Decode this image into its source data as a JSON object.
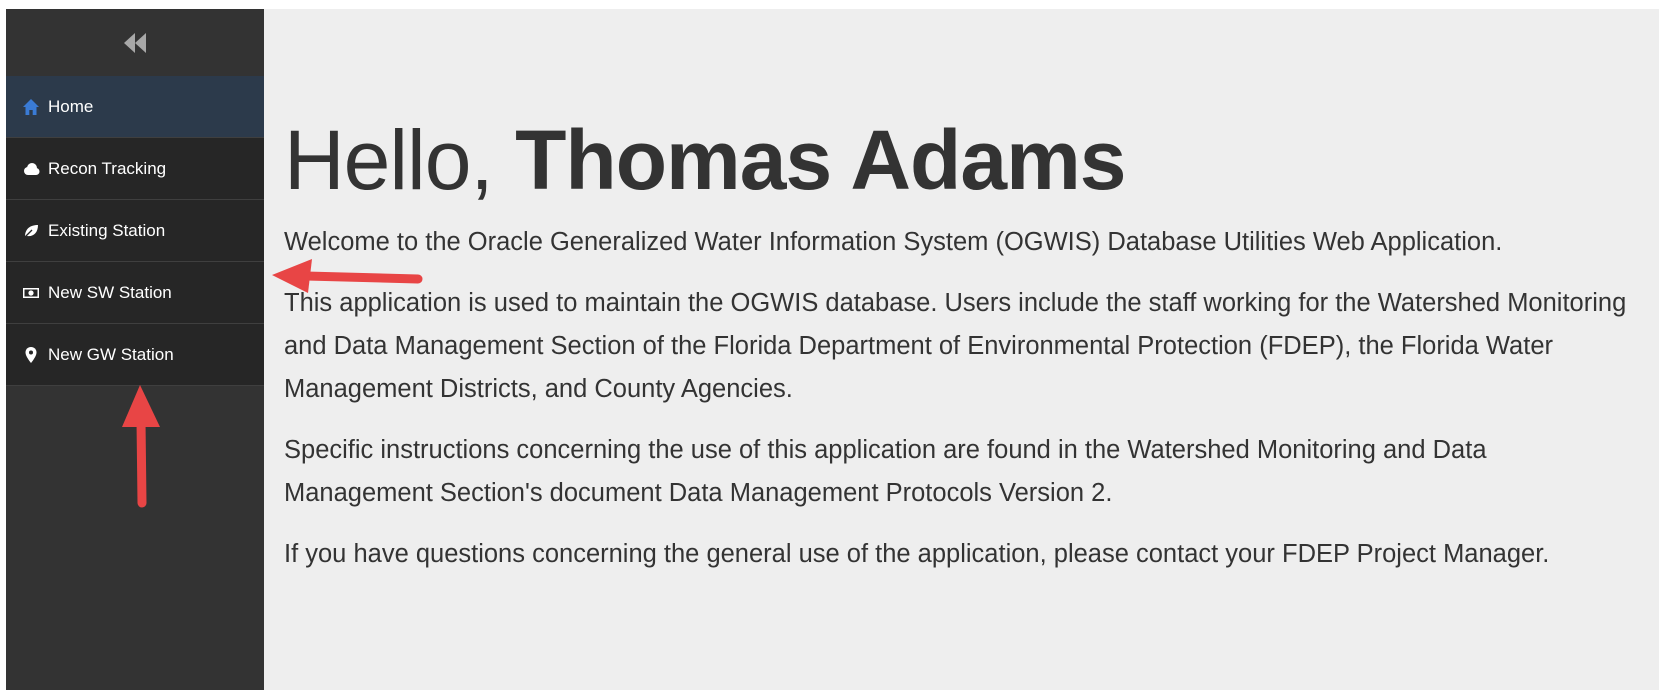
{
  "sidebar": {
    "collapse_icon": "double-chevron-left-icon",
    "items": [
      {
        "label": "Home",
        "icon": "home-icon",
        "active": true
      },
      {
        "label": "Recon Tracking",
        "icon": "cloud-icon",
        "active": false
      },
      {
        "label": "Existing Station",
        "icon": "leaf-icon",
        "active": false
      },
      {
        "label": "New SW Station",
        "icon": "money-icon",
        "active": false
      },
      {
        "label": "New GW Station",
        "icon": "map-marker-icon",
        "active": false
      }
    ]
  },
  "main": {
    "greeting_prefix": "Hello,",
    "user_name": "Thomas Adams",
    "paragraphs": [
      "Welcome to the Oracle Generalized Water Information System (OGWIS) Database Utilities Web Application.",
      "This application is used to maintain the OGWIS database. Users include the staff working for the Watershed Monitoring and Data Management Section of the Florida Department of Environmental Protection (FDEP), the Florida Water Management Districts, and County Agencies.",
      "Specific instructions concerning the use of this application are found in the Watershed Monitoring and Data Management Section's document Data Management Protocols Version 2.",
      "If you have questions concerning the general use of the application, please contact your FDEP Project Manager."
    ]
  },
  "colors": {
    "sidebar_bg": "#333333",
    "nav_item_bg": "#262626",
    "nav_active_bg": "#2c3a4b",
    "home_icon": "#3a7bd5",
    "main_bg": "#eeeeee",
    "text": "#333333",
    "annotation_arrow": "#e84545"
  }
}
